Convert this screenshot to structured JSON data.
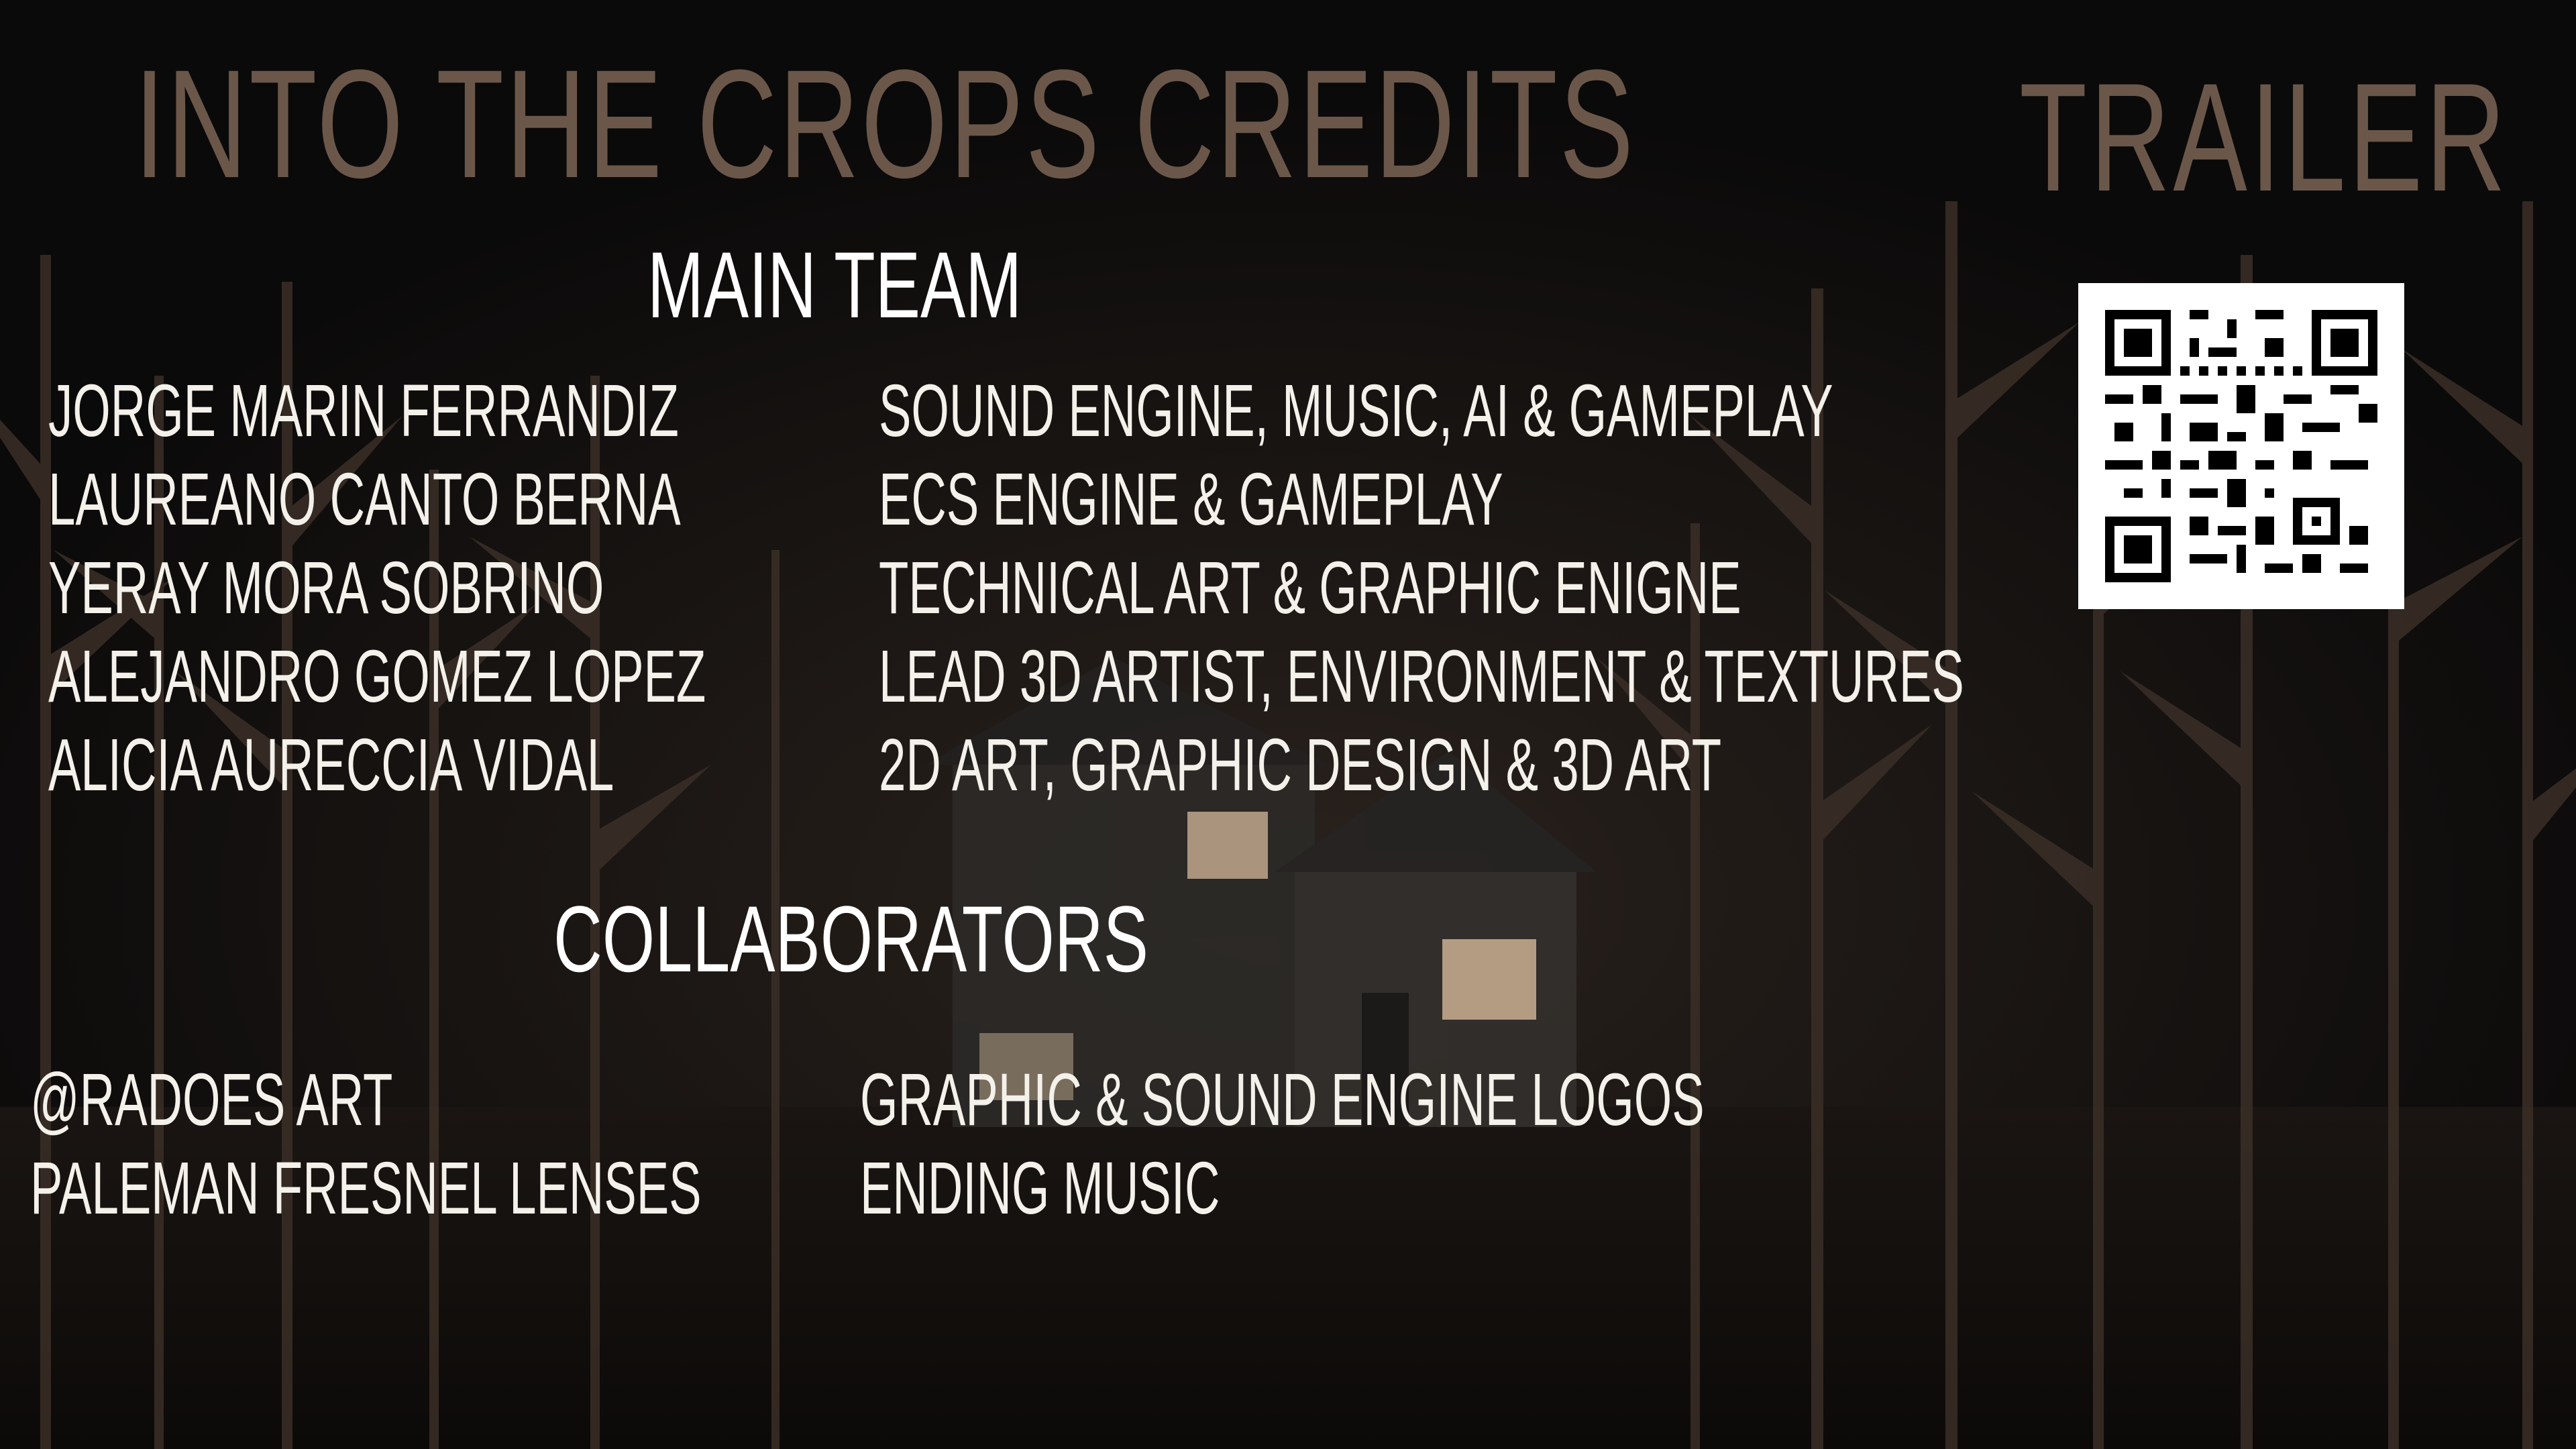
{
  "screen": {
    "title": "Into the Crops Credits",
    "trailer_label": "Trailer"
  },
  "main_team": {
    "heading": "Main Team",
    "members": [
      {
        "name": "Jorge Marin Ferrandiz",
        "role": "Sound Engine, Music, AI & Gameplay"
      },
      {
        "name": "Laureano Canto Berna",
        "role": "ECS Engine & Gameplay"
      },
      {
        "name": "Yeray Mora Sobrino",
        "role": "Technical Art & Graphic Enigne"
      },
      {
        "name": "Alejandro Gomez Lopez",
        "role": "Lead 3D Artist, Environment & Textures"
      },
      {
        "name": "Alicia Aureccia Vidal",
        "role": "2D Art, Graphic Design & 3D Art"
      }
    ]
  },
  "collaborators": {
    "heading": "Collaborators",
    "members": [
      {
        "name": "@Radoes Art",
        "role": "Graphic & Sound Engine Logos"
      },
      {
        "name": "Paleman Fresnel Lenses",
        "role": "Ending Music"
      }
    ]
  },
  "qr_code": {
    "icon": "qr-code-icon"
  },
  "colors": {
    "title": "#6b5749",
    "text": "#f4f0ea",
    "background": "#0b0a0a",
    "crops": "#3b2f27",
    "window_glow": "#e8c9a8"
  }
}
